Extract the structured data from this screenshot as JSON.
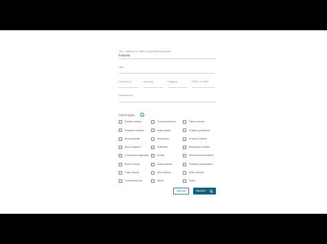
{
  "form": {
    "terms_hint": "Title, abstract or author-specified keywords",
    "terms_value": "fentanila",
    "title_label": "Title",
    "volume_label": "Volume(s)",
    "issue_label": "Issue(s)",
    "pages_label": "Page(s)",
    "issn_label": "ISSN or ISBN",
    "references_label": "References",
    "article_types_label": "Article types",
    "help_glyph": "?",
    "cancel_label": "Cancel",
    "search_label": "Search"
  },
  "article_types": {
    "col1": [
      "Review articles",
      "Research articles",
      "Encyclopedia",
      "Book chapters",
      "Conference abstracts",
      "Book reviews",
      "Case reports",
      "Conference info"
    ],
    "col2": [
      "Correspondence",
      "Data articles",
      "Discussion",
      "Editorials",
      "Errata",
      "Examinations",
      "Mini reviews",
      "News"
    ],
    "col3": [
      "Patent reports",
      "Practice guidelines",
      "Product reviews",
      "Replication studies",
      "Short communications",
      "Software publications",
      "Video articles",
      "Other"
    ]
  },
  "colors": {
    "accent": "#0f5f78",
    "outline": "#2a7d8c"
  },
  "icons": {
    "search": "search-icon",
    "help": "help-icon"
  }
}
